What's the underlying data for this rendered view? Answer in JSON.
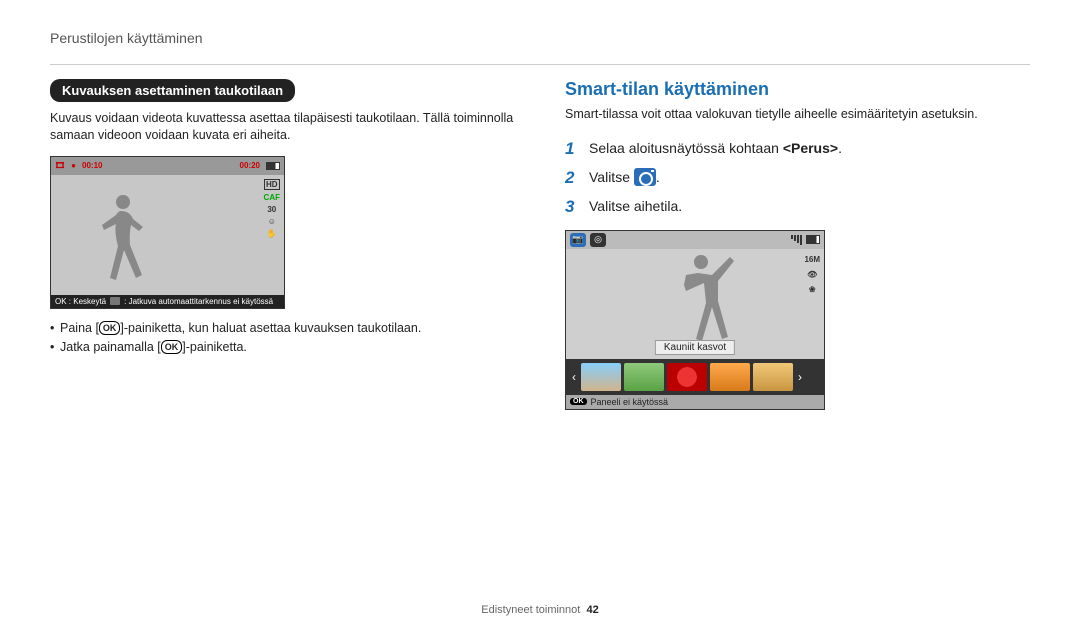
{
  "page": {
    "header": "Perustilojen käyttäminen",
    "footer_text": "Edistyneet toiminnot",
    "footer_page": "42"
  },
  "left": {
    "pill": "Kuvauksen asettaminen taukotilaan",
    "intro": "Kuvaus voidaan videota kuvattessa asettaa tilapäisesti taukotilaan. Tällä toiminnolla samaan videoon voidaan kuvata eri aiheita.",
    "mock": {
      "rec": "●",
      "time_left": "00:10",
      "time_right": "00:20",
      "caf": "CAF",
      "hd": "HD",
      "fps": "30",
      "ok_label": "OK : Keskeytä",
      "hint": ": Jatkuva automaattitarkennus ei käytössä"
    },
    "bullets": {
      "b1_pre": "Paina [",
      "b1_ok": "OK",
      "b1_post": "]-painiketta, kun haluat asettaa kuvauksen taukotilaan.",
      "b2_pre": "Jatka painamalla [",
      "b2_ok": "OK",
      "b2_post": "]-painiketta."
    }
  },
  "right": {
    "title": "Smart-tilan käyttäminen",
    "intro": "Smart-tilassa voit ottaa valokuvan tietylle aiheelle esimääritetyin asetuksin.",
    "steps": {
      "s1_num": "1",
      "s1_a": "Selaa aloitusnäytössä kohtaan ",
      "s1_b": "<Perus>",
      "s1_c": ".",
      "s2_num": "2",
      "s2_a": "Valitse ",
      "s2_b": ".",
      "s3_num": "3",
      "s3": "Valitse aihetila."
    },
    "mock": {
      "res": "16M",
      "label": "Kauniit kasvot",
      "ok": "OK",
      "bottom": "Paneeli ei käytössä"
    }
  }
}
